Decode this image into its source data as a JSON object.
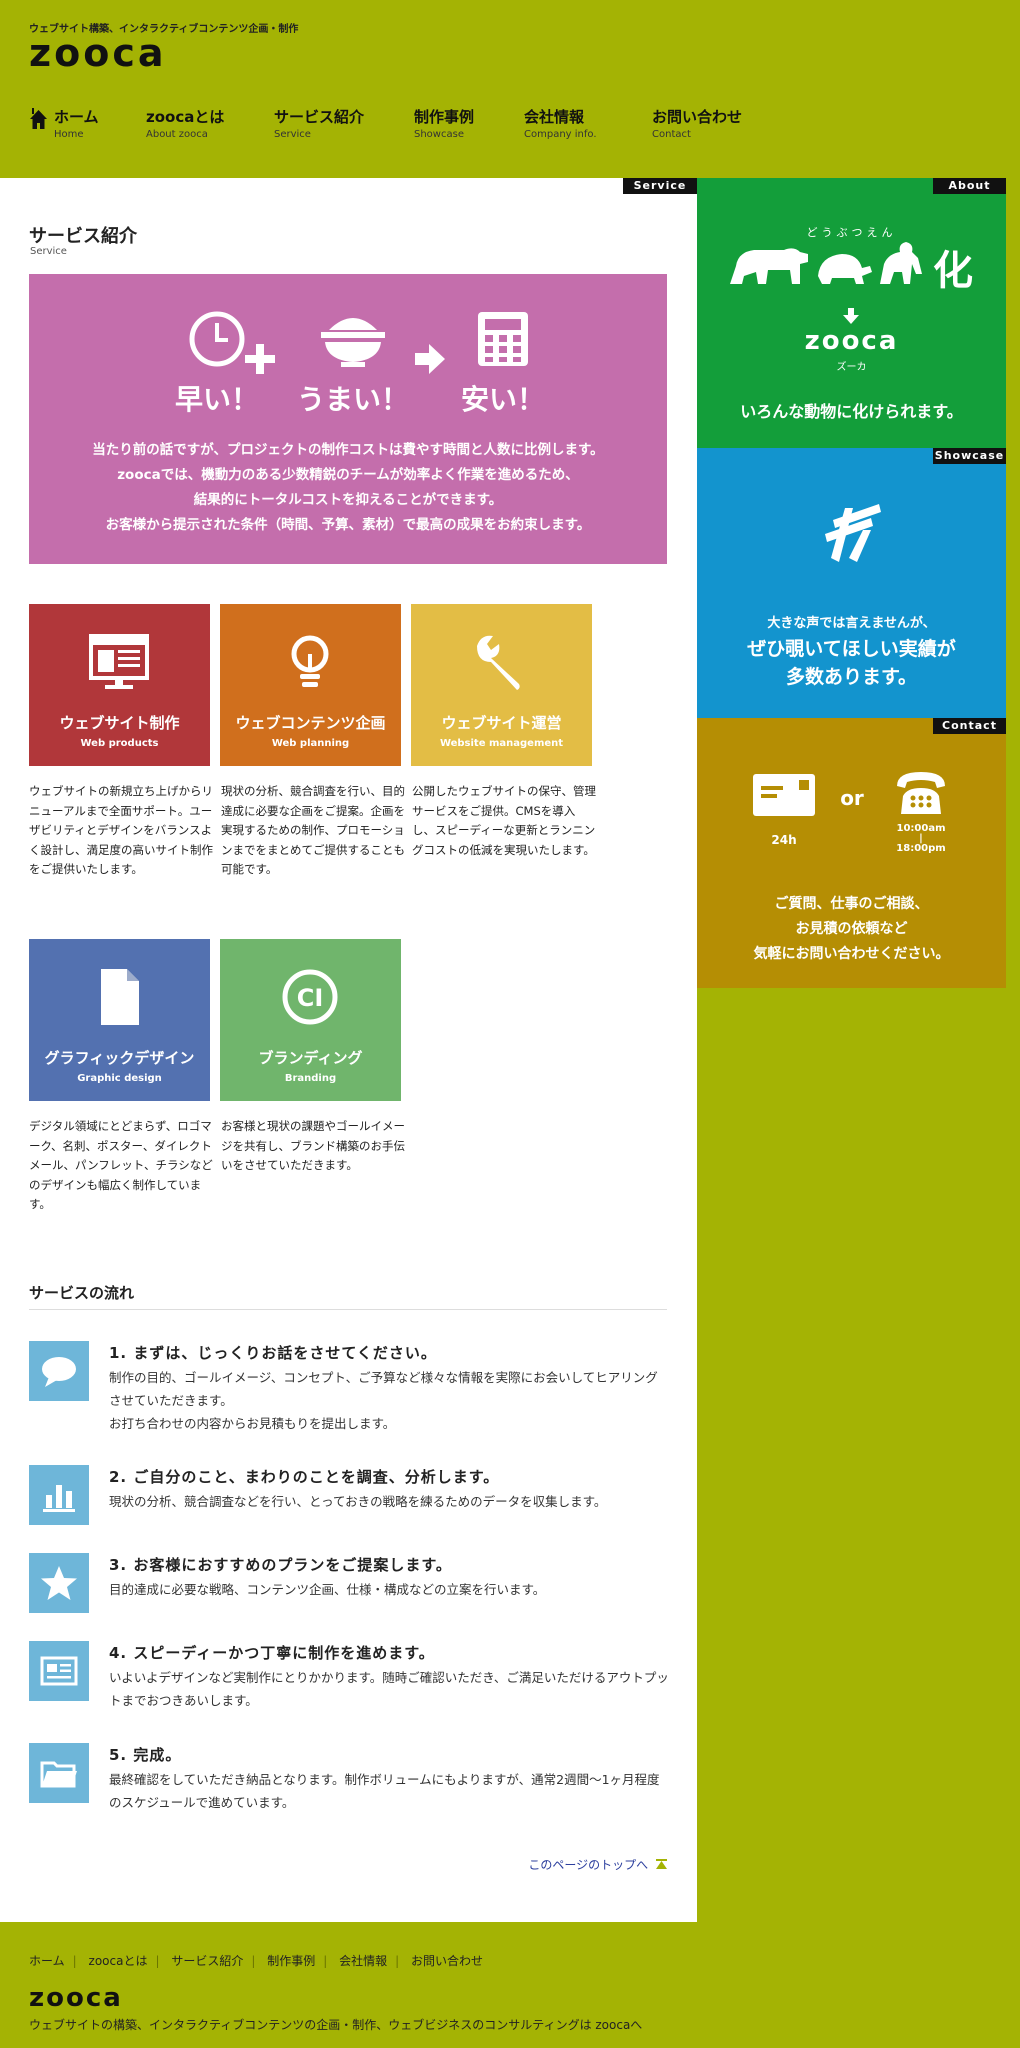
{
  "header": {
    "tagline": "ウェブサイト構築、インタラクティブコンテンツ企画・制作",
    "logo": "zooca"
  },
  "nav": [
    {
      "ja": "ホーム",
      "en": "Home"
    },
    {
      "ja": "zoocaとは",
      "en": "About zooca"
    },
    {
      "ja": "サービス紹介",
      "en": "Service"
    },
    {
      "ja": "制作事例",
      "en": "Showcase"
    },
    {
      "ja": "会社情報",
      "en": "Company info."
    },
    {
      "ja": "お問い合わせ",
      "en": "Contact"
    }
  ],
  "main": {
    "corner_tag": "Service",
    "title": "サービス紹介",
    "title_en": "Service",
    "hero": {
      "items": [
        "早い！",
        "うまい！",
        "安い！"
      ],
      "text": [
        "当たり前の話ですが、プロジェクトの制作コストは費やす時間と人数に比例します。",
        "zoocaでは、機動力のある少数精鋭のチームが効率よく作業を進めるため、",
        "結果的にトータルコストを抑えることができます。",
        "お客様から提示された条件（時間、予算、素材）で最高の成果をお約束します。"
      ]
    },
    "services": [
      {
        "title": "ウェブサイト制作",
        "en": "Web products",
        "color": "#b1373a",
        "icon": "browser-icon",
        "desc": "ウェブサイトの新規立ち上げからリニューアルまで全面サポート。ユーザビリティとデザインをバランスよく設計し、満足度の高いサイト制作をご提供いたします。"
      },
      {
        "title": "ウェブコンテンツ企画",
        "en": "Web planning",
        "color": "#d06f1d",
        "icon": "lightbulb-icon",
        "desc": "現状の分析、競合調査を行い、目的達成に必要な企画をご提案。企画を実現するための制作、プロモーションまでをまとめてご提供することも可能です。"
      },
      {
        "title": "ウェブサイト運営",
        "en": "Website management",
        "color": "#e3bd45",
        "icon": "wrench-icon",
        "desc": "公開したウェブサイトの保守、管理サービスをご提供。CMSを導入し、スピーディーな更新とランニングコストの低減を実現いたします。"
      },
      {
        "title": "グラフィックデザイン",
        "en": "Graphic design",
        "color": "#5371b0",
        "icon": "document-icon",
        "desc": "デジタル領域にとどまらず、ロゴマーク、名刺、ポスター、ダイレクトメール、パンフレット、チラシなどのデザインも幅広く制作しています。"
      },
      {
        "title": "ブランディング",
        "en": "Branding",
        "color": "#70b56c",
        "icon": "ci-icon",
        "desc": "お客様と現状の課題やゴールイメージを共有し、ブランド構築のお手伝いをさせていただきます。"
      }
    ],
    "flow_title": "サービスの流れ",
    "steps": [
      {
        "title": "1. まずは、じっくりお話をさせてください。",
        "icon": "speech-bubble-icon",
        "lines": [
          "制作の目的、ゴールイメージ、コンセプト、ご予算など様々な情報を実際にお会いしてヒアリングさせていただきます。",
          "お打ち合わせの内容からお見積もりを提出します。"
        ]
      },
      {
        "title": "2. ご自分のこと、まわりのことを調査、分析します。",
        "icon": "bar-chart-icon",
        "lines": [
          "現状の分析、競合調査などを行い、とっておきの戦略を練るためのデータを収集します。"
        ]
      },
      {
        "title": "3. お客様におすすめのプランをご提案します。",
        "icon": "star-icon",
        "lines": [
          "目的達成に必要な戦略、コンテンツ企画、仕様・構成などの立案を行います。"
        ]
      },
      {
        "title": "4. スピーディーかつ丁寧に制作を進めます。",
        "icon": "layout-icon",
        "lines": [
          "いよいよデザインなど実制作にとりかかります。随時ご確認いただき、ご満足いただけるアウトプットまでおつきあいします。"
        ]
      },
      {
        "title": "5. 完成。",
        "icon": "folder-icon",
        "lines": [
          "最終確認をしていただき納品となります。制作ボリュームにもよりますが、通常2週間〜1ヶ月程度のスケジュールで進めています。"
        ]
      }
    ],
    "pagetop": "このページのトップへ"
  },
  "sidebar": {
    "about": {
      "tag": "About",
      "kana": "どうぶつえん",
      "ka": "化",
      "logo": "zooca",
      "logo_kana": "ズーカ",
      "text": "いろんな動物に化けられます。",
      "color": "#139e3a"
    },
    "showcase": {
      "tag": "Showcase",
      "line1": "大きな声では言えませんが、",
      "line2": "ぜひ覗いてほしい実績が",
      "line3": "多数あります。",
      "color": "#1394ce"
    },
    "contact": {
      "tag": "Contact",
      "mail_label": "24h",
      "or": "or",
      "tel_from": "10:00am",
      "tel_sep": "|",
      "tel_to": "18:00pm",
      "line1": "ご質問、仕事のご相談、",
      "line2": "お見積の依頼など",
      "line3": "気軽にお問い合わせください。",
      "color": "#b58e04"
    }
  },
  "footer": {
    "links": [
      "ホーム",
      "zoocaとは",
      "サービス紹介",
      "制作事例",
      "会社情報",
      "お問い合わせ"
    ],
    "logo": "zooca",
    "tagline": "ウェブサイトの構築、インタラクティブコンテンツの企画・制作、ウェブビジネスのコンサルティングは zoocaへ"
  }
}
